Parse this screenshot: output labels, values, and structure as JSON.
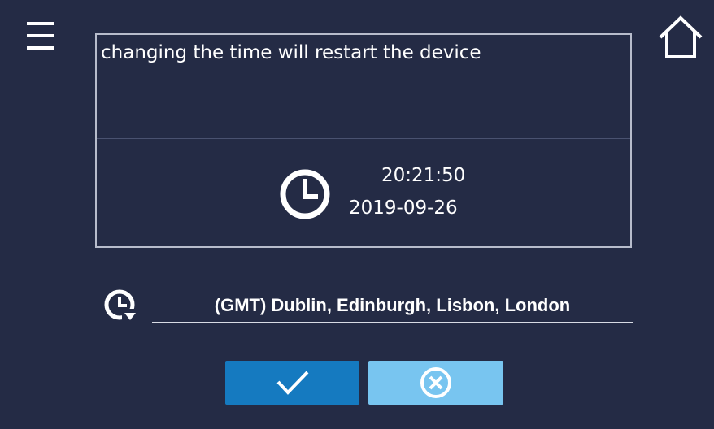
{
  "header": {
    "menu_icon": "hamburger-menu-icon",
    "home_icon": "home-icon"
  },
  "info_panel": {
    "warning_text": "changing the time will restart the device",
    "clock_icon": "clock-icon",
    "time": "20:21:50",
    "date": "2019-09-26"
  },
  "timezone": {
    "icon": "timezone-clock-dropdown-icon",
    "value": "(GMT) Dublin, Edinburgh, Lisbon, London"
  },
  "buttons": {
    "confirm_icon": "checkmark-icon",
    "cancel_icon": "close-circle-icon"
  },
  "colors": {
    "background": "#242b45",
    "panel_border": "#b7bccb",
    "confirm_button": "#157ac0",
    "cancel_button": "#78c5f0",
    "text": "#ffffff"
  }
}
